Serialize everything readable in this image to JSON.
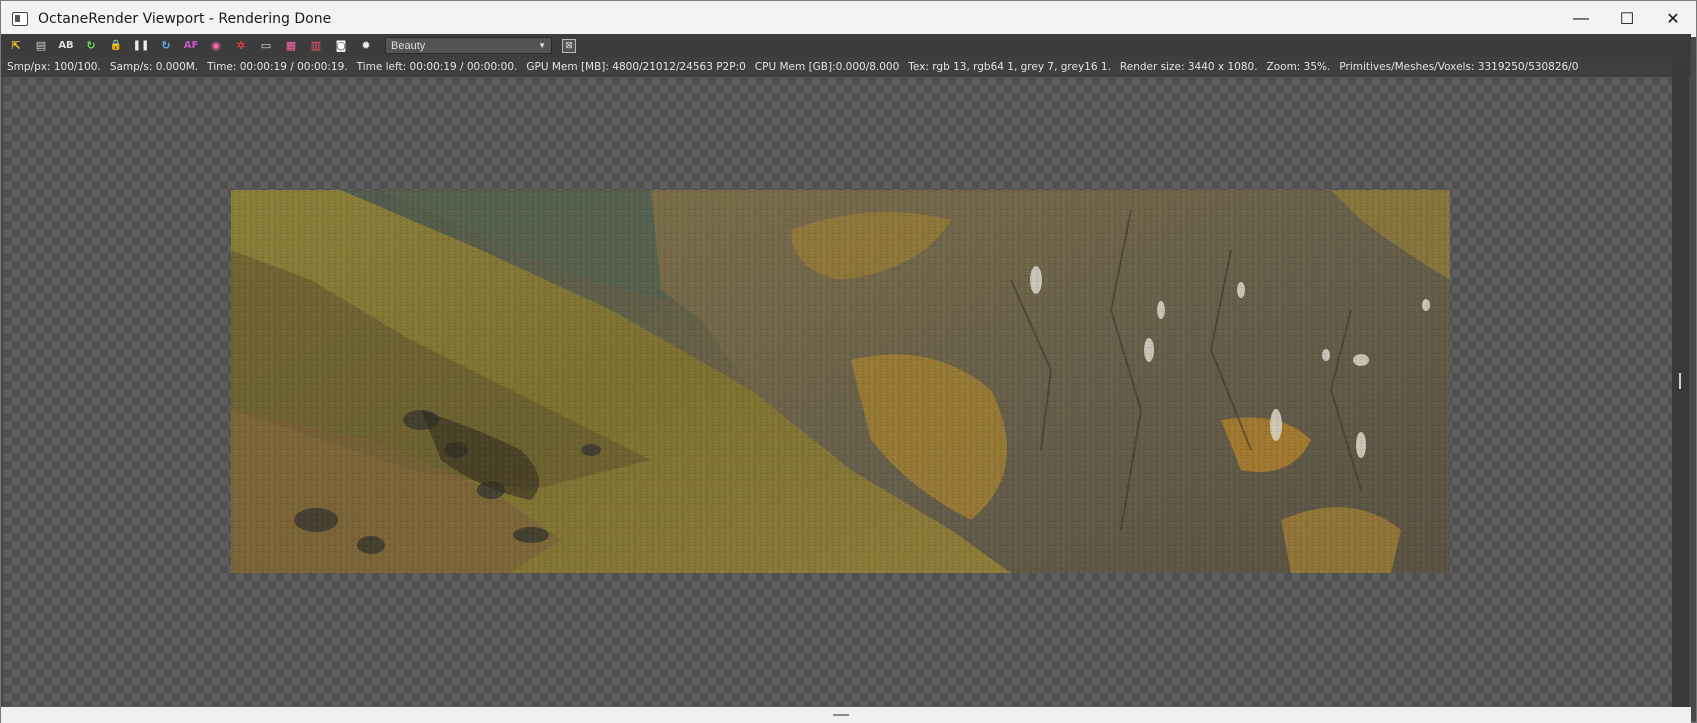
{
  "window": {
    "title": "OctaneRender Viewport - Rendering Done",
    "controls": {
      "minimize": "—",
      "maximize": "☐",
      "close": "✕"
    }
  },
  "toolbar": {
    "buttons": [
      {
        "name": "recenter-view",
        "glyph": "⇱",
        "color": "#ffcc33"
      },
      {
        "name": "save-render",
        "glyph": "▤",
        "color": "#cccccc"
      },
      {
        "name": "ab-compare",
        "glyph": "AB",
        "color": "#dddddd"
      },
      {
        "name": "restart-render",
        "glyph": "↻",
        "color": "#66dd55"
      },
      {
        "name": "lock",
        "glyph": "🔒",
        "color": "#dddddd"
      },
      {
        "name": "pause-render",
        "glyph": "❚❚",
        "color": "#eeeeee"
      },
      {
        "name": "start-render",
        "glyph": "↻",
        "color": "#66aaee"
      },
      {
        "name": "aov",
        "glyph": "AF",
        "color": "#cc55cc"
      },
      {
        "name": "color-picker",
        "glyph": "◉",
        "color": "#ff66aa"
      },
      {
        "name": "region-render",
        "glyph": "✲",
        "color": "#ff4444"
      },
      {
        "name": "viewport-settings",
        "glyph": "▭",
        "color": "#dddddd"
      },
      {
        "name": "film-region",
        "glyph": "▦",
        "color": "#ff66aa"
      },
      {
        "name": "render-layers",
        "glyph": "▥",
        "color": "#ff5566"
      },
      {
        "name": "camera",
        "glyph": "◙",
        "color": "#ffffff"
      },
      {
        "name": "settings",
        "glyph": "✹",
        "color": "#eeeeee"
      }
    ],
    "pass_select": "Beauty",
    "fit_button": "⊠"
  },
  "status": {
    "samples_per_px": "Smp/px: 100/100.",
    "samples_per_sec": "Samp/s: 0.000M.",
    "time": "Time: 00:00:19 / 00:00:19.",
    "time_left": "Time left: 00:00:19 / 00:00:00.",
    "gpu_mem": "GPU Mem [MB]: 4800/21012/24563 P2P:0",
    "cpu_mem": "CPU Mem [GB]:0.000/8.000",
    "tex": "Tex: rgb 13, rgb64 1, grey 7, grey16 1.",
    "render_size": "Render size: 3440 x 1080.",
    "zoom": "Zoom: 35%.",
    "primitives": "Primitives/Meshes/Voxels: 3319250/530826/0"
  },
  "render": {
    "description_icon": "mountain-landscape-render",
    "colors": {
      "grass": "#8a7d3c",
      "rock": "#6a6148",
      "shadow": "#3a3424",
      "autumn": "#a07a35",
      "haze": "#5d6652"
    }
  }
}
